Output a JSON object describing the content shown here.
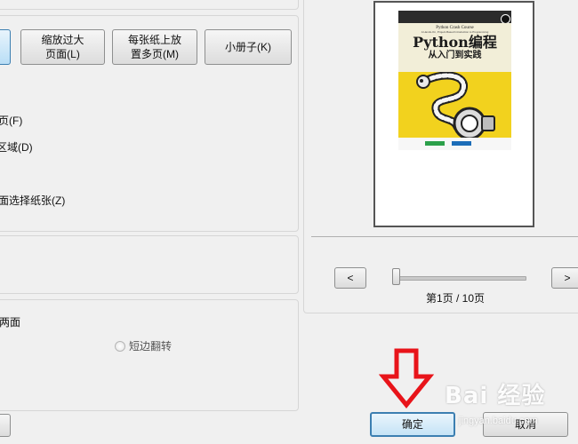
{
  "page_layout": {
    "buttons": [
      {
        "label_line1": "缩放过大",
        "label_line2": "页面(L)"
      },
      {
        "label_line1": "每张纸上放",
        "label_line2": "置多页(M)"
      },
      {
        "label_line1": "小册子(K)",
        "label_line2": ""
      }
    ],
    "options": [
      {
        "label": "页(F)"
      },
      {
        "label": "区域(D)"
      },
      {
        "label": "面选择纸张(Z)"
      }
    ]
  },
  "duplex": {
    "label": "两面",
    "radio_label": "短边翻转"
  },
  "preview": {
    "book_title": "Python编程",
    "book_subtitle": "从入门到实践",
    "book_en_title": "Python Crash Course",
    "book_en_subtitle": "A Hands-On, Project-Based Introduction to Programming",
    "page_indicator": "第1页 / 10页",
    "prev_label": "<",
    "next_label": ">",
    "slider_value": 0.0
  },
  "footer": {
    "ok_label": "确定",
    "cancel_label": "取消"
  },
  "watermark": {
    "text": "Bai 经验",
    "url": "jingyan.baidu.com"
  },
  "colors": {
    "cover_yellow": "#f2d21e",
    "arrow_red": "#e8141a",
    "ok_focus": "#3c7fb1"
  }
}
